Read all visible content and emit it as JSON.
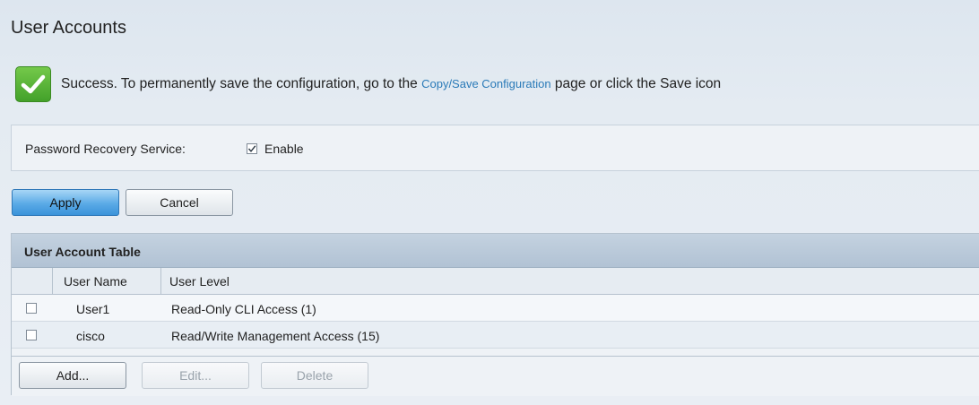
{
  "page": {
    "title": "User Accounts"
  },
  "status": {
    "icon": "check-icon",
    "message_before": "Success. To permanently save the configuration, go to the ",
    "link_text": "Copy/Save Configuration",
    "message_after": " page or click the Save icon",
    "accent_color": "#4caf2e",
    "link_color": "#2a7ab8"
  },
  "password_recovery": {
    "label": "Password Recovery Service:",
    "enable_label": "Enable",
    "enabled": true
  },
  "form_buttons": {
    "apply_label": "Apply",
    "cancel_label": "Cancel"
  },
  "user_table": {
    "caption": "User Account Table",
    "columns": [
      "User Name",
      "User Level"
    ],
    "rows": [
      {
        "checked": false,
        "user_name": "User1",
        "user_level": "Read-Only CLI Access (1)"
      },
      {
        "checked": false,
        "user_name": "cisco",
        "user_level": "Read/Write Management Access (15)"
      }
    ],
    "buttons": {
      "add_label": "Add...",
      "edit_label": "Edit...",
      "delete_label": "Delete"
    }
  }
}
